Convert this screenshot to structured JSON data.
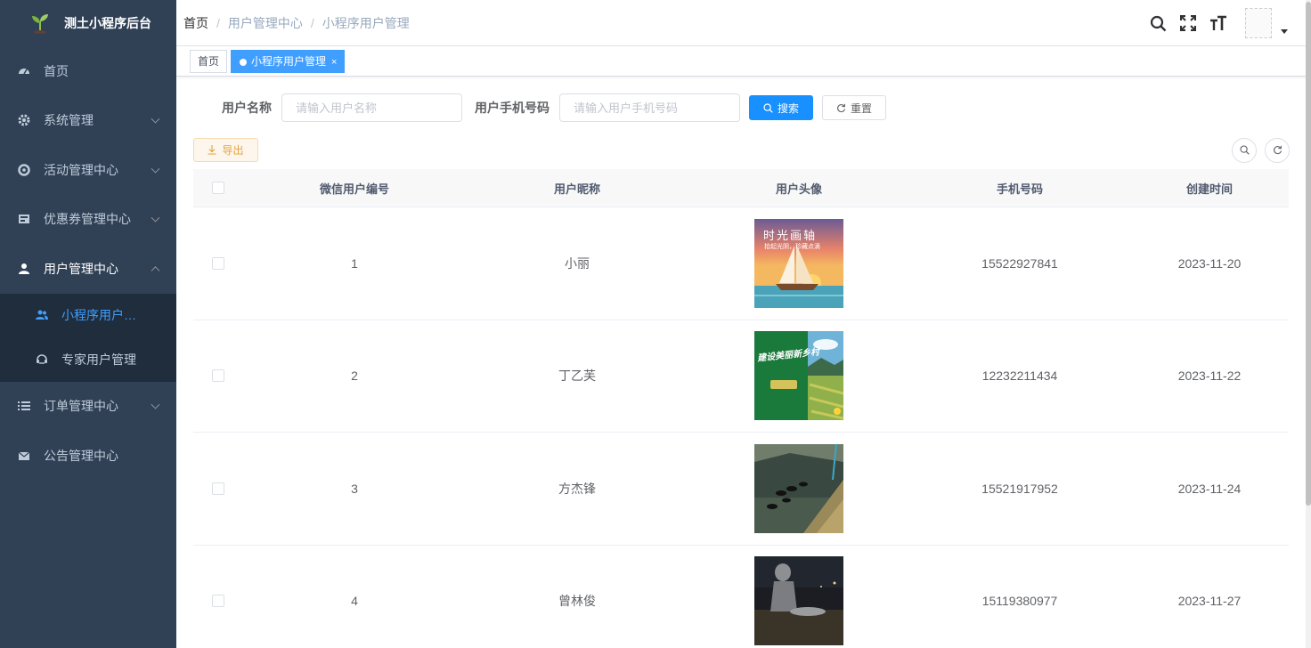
{
  "app": {
    "title": "测土小程序后台"
  },
  "sidebar": {
    "items": [
      {
        "label": "首页",
        "icon": "dashboard-icon"
      },
      {
        "label": "系统管理",
        "icon": "gear-icon"
      },
      {
        "label": "活动管理中心",
        "icon": "activity-icon"
      },
      {
        "label": "优惠券管理中心",
        "icon": "coupon-icon"
      },
      {
        "label": "用户管理中心",
        "icon": "user-icon"
      },
      {
        "label": "订单管理中心",
        "icon": "list-icon"
      },
      {
        "label": "公告管理中心",
        "icon": "mail-icon"
      }
    ],
    "subitems": [
      {
        "label": "小程序用户…",
        "icon": "users-icon"
      },
      {
        "label": "专家用户管理",
        "icon": "expert-icon"
      }
    ]
  },
  "breadcrumb": [
    "首页",
    "用户管理中心",
    "小程序用户管理"
  ],
  "tags": {
    "home": "首页",
    "active": "小程序用户管理",
    "close": "×"
  },
  "search": {
    "name_label": "用户名称",
    "name_placeholder": "请输入用户名称",
    "phone_label": "用户手机号码",
    "phone_placeholder": "请输入用户手机号码",
    "search_btn": "搜索",
    "reset_btn": "重置"
  },
  "toolbar": {
    "export_btn": "导出"
  },
  "table": {
    "headers": [
      "微信用户编号",
      "用户昵称",
      "用户头像",
      "手机号码",
      "创建时间"
    ],
    "rows": [
      {
        "id": "1",
        "nickname": "小丽",
        "avatar_text": "时光画轴",
        "avatar_sub": "拾起光阴，珍藏点滴",
        "phone": "15522927841",
        "created": "2023-11-20"
      },
      {
        "id": "2",
        "nickname": "丁乙芙",
        "avatar_text": "建设美丽新乡村",
        "phone": "12232211434",
        "created": "2023-11-22"
      },
      {
        "id": "3",
        "nickname": "方杰锋",
        "phone": "15521917952",
        "created": "2023-11-24"
      },
      {
        "id": "4",
        "nickname": "曾林俊",
        "phone": "15119380977",
        "created": "2023-11-27"
      }
    ]
  },
  "colors": {
    "sidebar_bg": "#304156",
    "submenu_bg": "#1f2d3d",
    "primary": "#1890ff",
    "active_text": "#409eff",
    "warning": "#e6a23c"
  }
}
